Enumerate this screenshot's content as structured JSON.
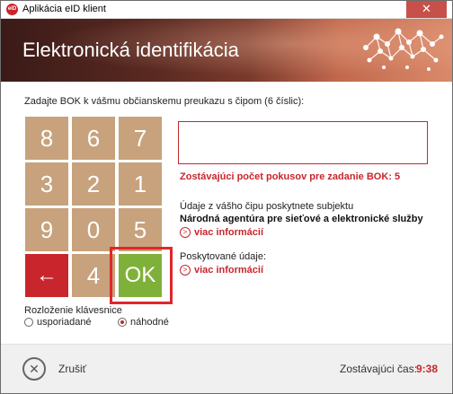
{
  "window": {
    "title": "Aplikácia eID klient",
    "app_icon_text": "eID",
    "close_symbol": "✕"
  },
  "banner": {
    "title": "Elektronická identifikácia"
  },
  "instruction": "Zadajte BOK k vášmu občianskemu preukazu s čipom (6 číslic):",
  "keypad": {
    "rows": [
      [
        "8",
        "6",
        "7"
      ],
      [
        "3",
        "2",
        "1"
      ],
      [
        "9",
        "0",
        "5"
      ],
      [
        "←",
        "4",
        "OK"
      ]
    ]
  },
  "layout": {
    "label": "Rozloženie klávesnice",
    "options": [
      {
        "label": "usporiadané",
        "checked": false
      },
      {
        "label": "náhodné",
        "checked": true
      }
    ]
  },
  "pin_input": {
    "value": ""
  },
  "attempts_text": "Zostávajúci počet pokusov pre zadanie BOK: 5",
  "subject": {
    "label": "Údaje z vášho čipu poskytnete subjektu",
    "name": "Národná agentúra pre sieťové a elektronické služby",
    "more_link": "viac informácií"
  },
  "provided": {
    "label": "Poskytované údaje:",
    "more_link": "viac informácií"
  },
  "footer": {
    "cancel_label": "Zrušiť",
    "cancel_symbol": "✕",
    "remaining_label": "Zostávajúci čas:",
    "remaining_value": "9:38"
  },
  "colors": {
    "accent": "#c8262c",
    "key": "#c7a27c",
    "ok": "#7fb13a"
  }
}
